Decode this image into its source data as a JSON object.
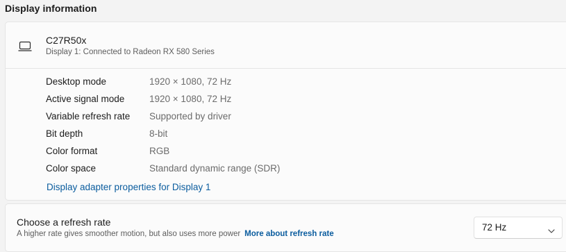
{
  "section": {
    "title": "Display information"
  },
  "monitor": {
    "icon": "laptop-icon",
    "name": "C27R50x",
    "subtitle": "Display 1: Connected to Radeon RX 580 Series"
  },
  "details": [
    {
      "label": "Desktop mode",
      "value": "1920 × 1080, 72 Hz"
    },
    {
      "label": "Active signal mode",
      "value": "1920 × 1080, 72 Hz"
    },
    {
      "label": "Variable refresh rate",
      "value": "Supported by driver"
    },
    {
      "label": "Bit depth",
      "value": "8-bit"
    },
    {
      "label": "Color format",
      "value": "RGB"
    },
    {
      "label": "Color space",
      "value": "Standard dynamic range (SDR)"
    }
  ],
  "adapter_link": "Display adapter properties for Display 1",
  "refresh": {
    "title": "Choose a refresh rate",
    "description": "A higher rate gives smoother motion, but also uses more power",
    "link": "More about refresh rate",
    "selected": "72 Hz",
    "chevron_icon": "chevron-down-icon"
  },
  "colors": {
    "link": "#0a5c9e",
    "background": "#f3f3f3",
    "card": "#fbfbfb"
  }
}
